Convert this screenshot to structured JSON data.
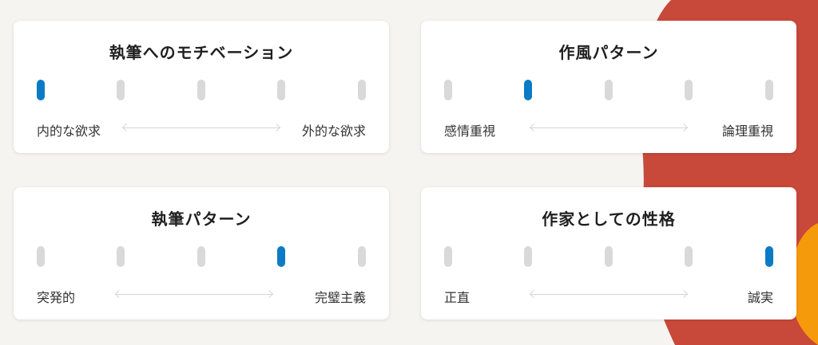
{
  "cards": [
    {
      "title": "執筆へのモチベーション",
      "left_label": "内的な欲求",
      "right_label": "外的な欲求",
      "steps": 5,
      "selected": 1
    },
    {
      "title": "作風パターン",
      "left_label": "感情重視",
      "right_label": "論理重視",
      "steps": 5,
      "selected": 2
    },
    {
      "title": "執筆パターン",
      "left_label": "突発的",
      "right_label": "完璧主義",
      "steps": 5,
      "selected": 4
    },
    {
      "title": "作家としての性格",
      "left_label": "正直",
      "right_label": "誠実",
      "steps": 5,
      "selected": 5
    }
  ],
  "colors": {
    "selected": "#0a7bc4",
    "unselected": "#d9d9d9",
    "blob_red": "#c8483a",
    "blob_orange": "#f59a0b"
  }
}
